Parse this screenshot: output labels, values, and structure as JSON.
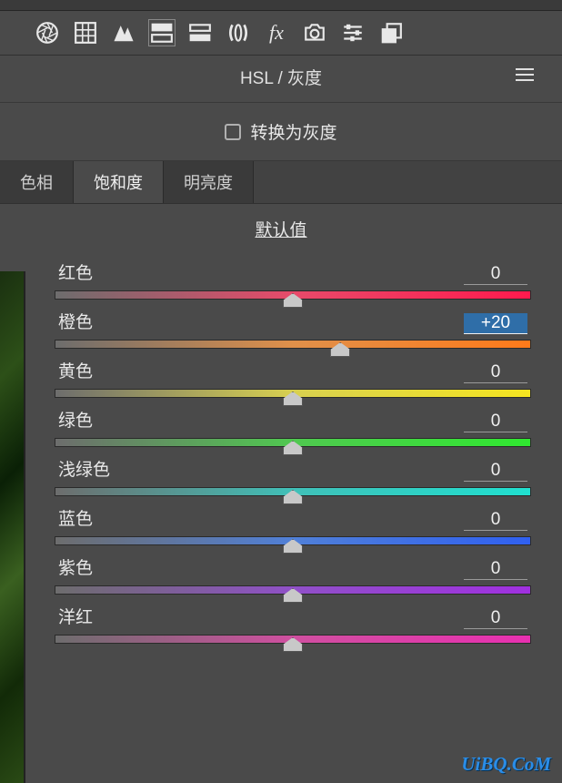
{
  "panel": {
    "title": "HSL / 灰度",
    "grayscale_label": "转换为灰度",
    "grayscale_checked": false,
    "default_label": "默认值"
  },
  "tabs": [
    {
      "label": "色相",
      "active": false
    },
    {
      "label": "饱和度",
      "active": true
    },
    {
      "label": "明亮度",
      "active": false
    }
  ],
  "sliders": [
    {
      "name": "red",
      "label": "红色",
      "value": "0",
      "pos": 50,
      "highlight": false,
      "gradient": "linear-gradient(90deg, #6d6d6d, #e84a6a, #ff1a4d)"
    },
    {
      "name": "orange",
      "label": "橙色",
      "value": "+20",
      "pos": 60,
      "highlight": true,
      "gradient": "linear-gradient(90deg, #6d6d6d, #e0904a, #ff7a1a)"
    },
    {
      "name": "yellow",
      "label": "黄色",
      "value": "0",
      "pos": 50,
      "highlight": false,
      "gradient": "linear-gradient(90deg, #6d6d6d, #d8d050, #f5e520)"
    },
    {
      "name": "green",
      "label": "绿色",
      "value": "0",
      "pos": 50,
      "highlight": false,
      "gradient": "linear-gradient(90deg, #6d6d6d, #50c850, #30e830)"
    },
    {
      "name": "aqua",
      "label": "浅绿色",
      "value": "0",
      "pos": 50,
      "highlight": false,
      "gradient": "linear-gradient(90deg, #6d6d6d, #40c0b8, #20e0d0)"
    },
    {
      "name": "blue",
      "label": "蓝色",
      "value": "0",
      "pos": 50,
      "highlight": false,
      "gradient": "linear-gradient(90deg, #6d6d6d, #5080d8, #3060f0)"
    },
    {
      "name": "purple",
      "label": "紫色",
      "value": "0",
      "pos": 50,
      "highlight": false,
      "gradient": "linear-gradient(90deg, #6d6d6d, #9050c8, #a030e0)"
    },
    {
      "name": "magenta",
      "label": "洋红",
      "value": "0",
      "pos": 50,
      "highlight": false,
      "gradient": "linear-gradient(90deg, #6d6d6d, #d04fa0, #e830b0)"
    }
  ],
  "watermark": "UiBQ.CoM"
}
